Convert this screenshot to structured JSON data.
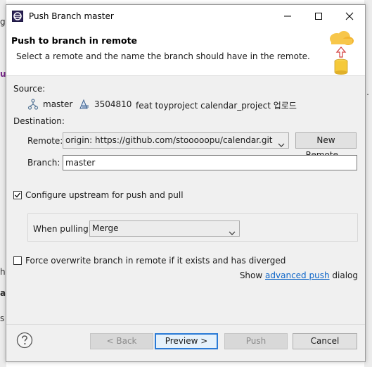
{
  "background": {
    "left_fragments": [
      "g",
      "ub",
      "h",
      "a",
      "s"
    ],
    "right_fragments": [
      "."
    ]
  },
  "window": {
    "title": "Push Branch master",
    "controls": {
      "minimize": "—",
      "maximize": "☐",
      "close": "✕"
    }
  },
  "header": {
    "title": "Push to branch in remote",
    "description": "Select a remote and the name the branch should have in the remote."
  },
  "source": {
    "label": "Source:",
    "branch": "master",
    "commit_id": "3504810",
    "commit_message": "feat toyproject calendar_project 업로드"
  },
  "destination": {
    "label": "Destination:",
    "remote_label": "Remote:",
    "remote_value": "origin: https://github.com/stooooopu/calendar.git",
    "new_remote_button": "New Remote...",
    "branch_label": "Branch:",
    "branch_value": "master"
  },
  "upstream": {
    "checkbox_label": "Configure upstream for push and pull",
    "checked": true,
    "when_pulling_label": "When pulling:",
    "when_pulling_value": "Merge"
  },
  "force": {
    "checkbox_label": "Force overwrite branch in remote if it exists and has diverged",
    "checked": false
  },
  "advanced": {
    "prefix": "Show",
    "link": "advanced push",
    "suffix": "dialog"
  },
  "buttons": {
    "back": "< Back",
    "preview": "Preview >",
    "push": "Push",
    "cancel": "Cancel"
  },
  "colors": {
    "accent": "#2a7ad6",
    "link": "#0b64c8",
    "dialog_bg": "#f0f0f0"
  }
}
